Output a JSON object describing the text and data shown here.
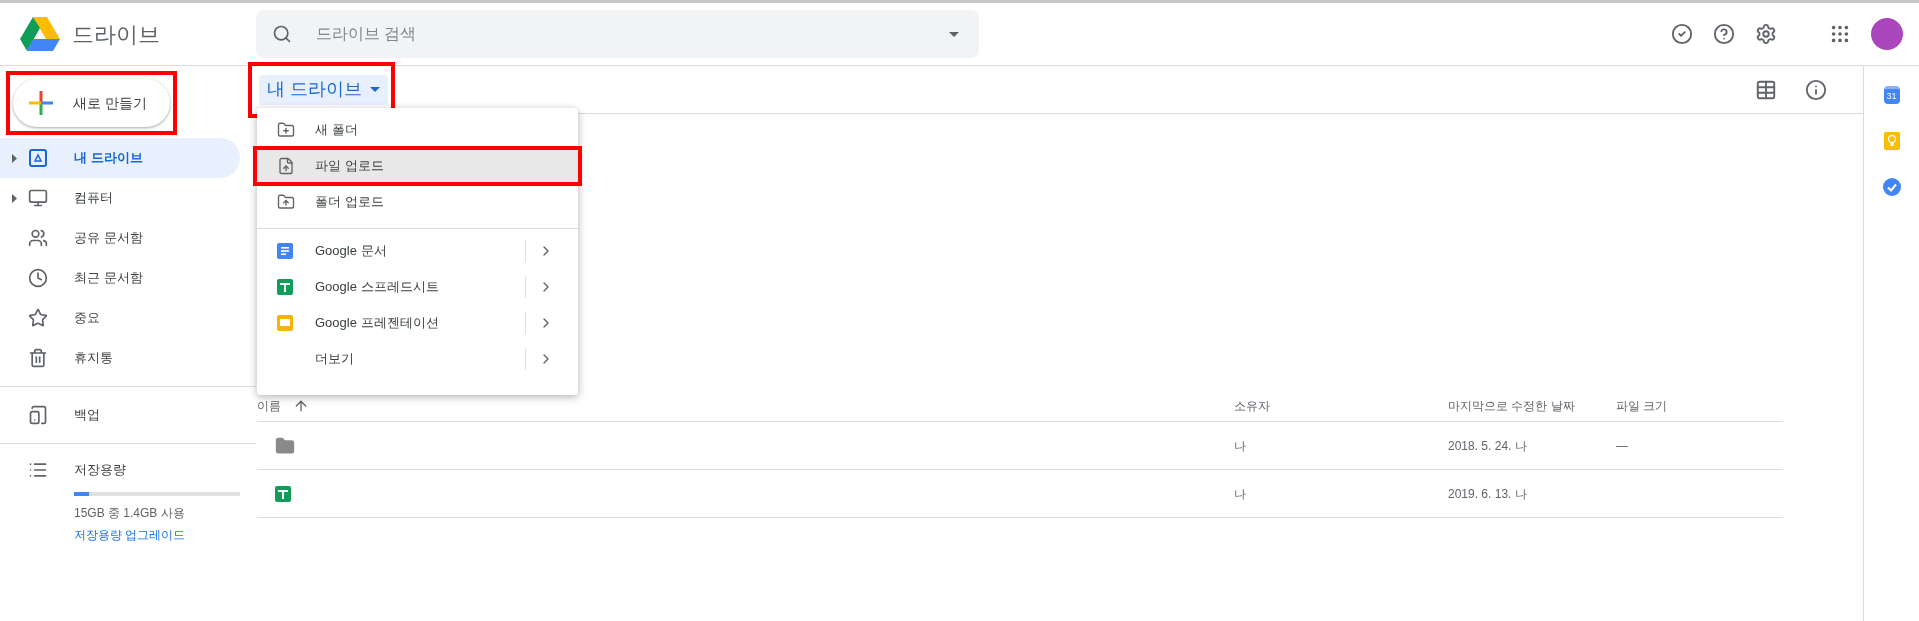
{
  "header": {
    "app_name": "드라이브",
    "search": {
      "placeholder": "드라이브 검색"
    }
  },
  "new_button": {
    "label": "새로 만들기",
    "highlighted": true
  },
  "sidebar": {
    "sections": [
      {
        "items": [
          {
            "kind": "drive",
            "label": "내 드라이브",
            "selected": true,
            "expandable": true
          },
          {
            "kind": "computer",
            "label": "컴퓨터",
            "selected": false,
            "expandable": true
          },
          {
            "kind": "shared",
            "label": "공유 문서함",
            "selected": false,
            "expandable": false
          },
          {
            "kind": "recent",
            "label": "최근 문서함",
            "selected": false,
            "expandable": false
          },
          {
            "kind": "starred",
            "label": "중요",
            "selected": false,
            "expandable": false
          },
          {
            "kind": "trash",
            "label": "휴지통",
            "selected": false,
            "expandable": false
          }
        ]
      },
      {
        "items": [
          {
            "kind": "backup",
            "label": "백업",
            "selected": false,
            "expandable": false
          }
        ]
      }
    ],
    "storage": {
      "label": "저장용량",
      "level": 0.09,
      "usage": "15GB 중 1.4GB 사용",
      "upgrade_link": "저장용량 업그레이드"
    }
  },
  "breadcrumb": {
    "label": "내 드라이브",
    "highlighted": true
  },
  "new_menu": {
    "sections": [
      {
        "items": [
          {
            "kind": "new-folder",
            "label": "새 폴더",
            "selected": false,
            "highlighted": false,
            "submenu": false
          },
          {
            "kind": "file-upload",
            "label": "파일 업로드",
            "selected": true,
            "highlighted": true,
            "submenu": false
          },
          {
            "kind": "folder-upload",
            "label": "폴더 업로드",
            "selected": false,
            "highlighted": false,
            "submenu": false
          }
        ]
      },
      {
        "items": [
          {
            "kind": "docs",
            "label": "Google 문서",
            "selected": false,
            "highlighted": false,
            "submenu": true
          },
          {
            "kind": "sheets",
            "label": "Google 스프레드시트",
            "selected": false,
            "highlighted": false,
            "submenu": true
          },
          {
            "kind": "slides",
            "label": "Google 프레젠테이션",
            "selected": false,
            "highlighted": false,
            "submenu": true
          },
          {
            "kind": "more",
            "label": "더보기",
            "selected": false,
            "highlighted": false,
            "submenu": true
          }
        ]
      }
    ]
  },
  "table": {
    "columns": [
      "이름",
      "소유자",
      "마지막으로 수정한 날짜",
      "파일 크기"
    ],
    "rows": [
      {
        "kind": "folder",
        "owner": "나",
        "modified": "2018. 5. 24. 나",
        "size": "—"
      },
      {
        "kind": "sheets",
        "owner": "나",
        "modified": "2019. 6. 13. 나"
      }
    ]
  },
  "side_panel": {
    "calendar_day": "31"
  }
}
